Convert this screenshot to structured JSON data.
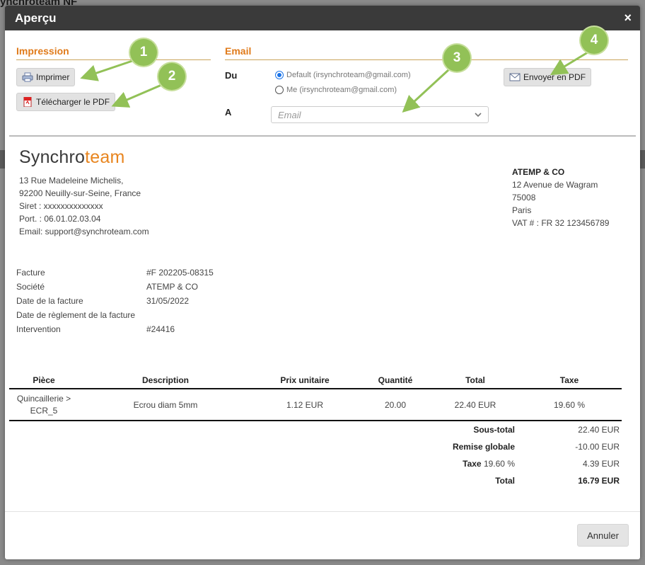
{
  "background": {
    "app_title": "ynchroteam NF"
  },
  "modal": {
    "title": "Aperçu",
    "close_glyph": "×",
    "impression": {
      "title": "Impression",
      "print_label": "Imprimer",
      "download_label": "Télécharger le PDF"
    },
    "email": {
      "title": "Email",
      "from_label": "Du",
      "options": [
        "Default (irsynchroteam@gmail.com)",
        "Me (irsynchroteam@gmail.com)"
      ],
      "selected_option": 0,
      "to_label": "A",
      "to_placeholder": "Email",
      "send_label": "Envoyer en PDF"
    },
    "badges": [
      "1",
      "2",
      "3",
      "4"
    ],
    "cancel_label": "Annuler"
  },
  "invoice": {
    "logo_main": "Synchro",
    "logo_accent": "team",
    "company_address": [
      "13 Rue Madeleine Michelis,",
      "92200 Neuilly-sur-Seine, France",
      "Siret : xxxxxxxxxxxxxx",
      "Port. : 06.01.02.03.04",
      "Email: support@synchroteam.com"
    ],
    "customer": {
      "name": "ATEMP & CO",
      "lines": [
        "12 Avenue de Wagram",
        "75008",
        "Paris",
        "VAT # : FR 32 123456789"
      ]
    },
    "info": [
      {
        "key": "Facture",
        "value": "#F 202205-08315"
      },
      {
        "key": "Société",
        "value": "ATEMP & CO"
      },
      {
        "key": "Date de la facture",
        "value": "31/05/2022"
      },
      {
        "key": "Date de règlement de la facture",
        "value": ""
      },
      {
        "key": "Intervention",
        "value": "#24416"
      }
    ],
    "table": {
      "headers": [
        "Pièce",
        "Description",
        "Prix unitaire",
        "Quantité",
        "Total",
        "Taxe"
      ],
      "rows": [
        {
          "piece_line1": "Quincaillerie >",
          "piece_line2": "ECR_5",
          "description": "Ecrou diam 5mm",
          "unit_price": "1.12 EUR",
          "quantity": "20.00",
          "total": "22.40 EUR",
          "tax": "19.60 %"
        }
      ]
    },
    "summary": {
      "subtotal_label": "Sous-total",
      "subtotal_value": "22.40 EUR",
      "discount_label": "Remise globale",
      "discount_value": "-10.00 EUR",
      "tax_label": "Taxe",
      "tax_rate": "19.60 %",
      "tax_value": "4.39 EUR",
      "total_label": "Total",
      "total_value": "16.79 EUR"
    }
  },
  "colors": {
    "accent": "#e07b1b",
    "header_bg": "#3a3a3a",
    "badge": "#92c157"
  }
}
